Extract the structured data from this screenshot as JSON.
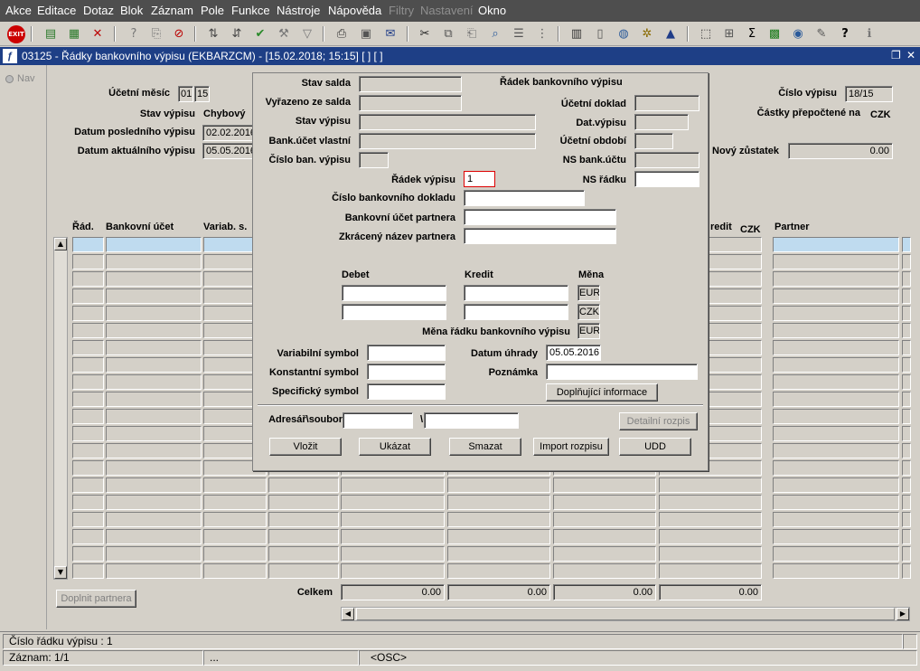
{
  "menu": [
    "Akce",
    "Editace",
    "Dotaz",
    "Blok",
    "Záznam",
    "Pole",
    "Funkce",
    "Nástroje",
    "Nápověda",
    "Filtry",
    "Nastavení",
    "Okno"
  ],
  "window": {
    "title": "03125 - Řádky bankovního výpisu (EKBARZCM) - [15.02.2018; 15:15] [ ] [ ]",
    "restore_icon": "restore-window-icon",
    "close_icon": "close-icon"
  },
  "sidebar": {
    "nav_label": "Nav"
  },
  "header": {
    "ucetni_mesic_label": "Účetní měsíc",
    "ucetni_mesic_1": "01",
    "ucetni_mesic_2": "15",
    "stav_vypisu_label": "Stav výpisu",
    "stav_vypisu_value": "Chybový",
    "datum_posledniho_label": "Datum posledního výpisu",
    "datum_posledniho_value": "02.02.2016",
    "datum_aktualniho_label": "Datum aktuálního výpisu",
    "datum_aktualniho_value": "05.05.2016",
    "cislo_vypisu_label": "Číslo výpisu",
    "cislo_vypisu_value": "18/15",
    "castky_label": "Částky přepočtené na",
    "castky_currency": "CZK",
    "novy_zustatek_label": "Nový zůstatek",
    "novy_zustatek_value": "0.00"
  },
  "table": {
    "col_rad": "Řád.",
    "col_ucet": "Bankovní účet",
    "col_variab": "Variab. s.",
    "col_kredit": "redit",
    "col_kredit_cur": "CZK",
    "col_partner": "Partner",
    "row_count": 20
  },
  "totals": {
    "label": "Celkem",
    "values": [
      "0.00",
      "0.00",
      "0.00",
      "0.00"
    ]
  },
  "doplnit_partnera": "Doplnit partnera",
  "dialog": {
    "stav_salda": "Stav salda",
    "vyrazeno_ze_salda": "Vyřazeno ze salda",
    "stav_vypisu": "Stav výpisu",
    "bank_ucet_vlastni": "Bank.účet vlastní",
    "cislo_ban_vypisu": "Číslo ban. výpisu",
    "radek_bv": "Řádek bankovního výpisu",
    "ucetni_doklad": "Účetní doklad",
    "dat_vypisu": "Dat.výpisu",
    "ucetni_obdobi": "Účetní období",
    "ns_bank_uctu": "NS bank.účtu",
    "radek_vypisu": "Řádek výpisu",
    "radek_vypisu_value": "1",
    "ns_radku": "NS řádku",
    "cislo_bank_dokladu": "Číslo bankovního dokladu",
    "bank_ucet_partnera": "Bankovní účet partnera",
    "zkraceny_nazev": "Zkrácený název partnera",
    "debet": "Debet",
    "kredit": "Kredit",
    "mena": "Měna",
    "mena_1": "EUR",
    "mena_2": "CZK",
    "mena_radku_label": "Měna řádku bankovního výpisu",
    "mena_radku_value": "EUR",
    "variabilni": "Variabilní symbol",
    "konstantni": "Konstantní symbol",
    "specificky": "Specifický symbol",
    "datum_uhrady": "Datum úhrady",
    "datum_uhrady_value": "05.05.2016",
    "poznamka": "Poznámka",
    "doplnujici": "Doplňující informace",
    "adresar": "Adresář\\soubor",
    "backslash": "\\",
    "detailni_rozpis": "Detailní rozpis",
    "buttons": {
      "vlozit": "Vložit",
      "ukazat": "Ukázat",
      "smazat": "Smazat",
      "import": "Import rozpisu",
      "udd": "UDD"
    }
  },
  "status": {
    "line1": "Číslo řádku výpisu : 1",
    "zaznam": "Záznam: 1/1",
    "dots": "...",
    "osc": "<OSC>"
  }
}
